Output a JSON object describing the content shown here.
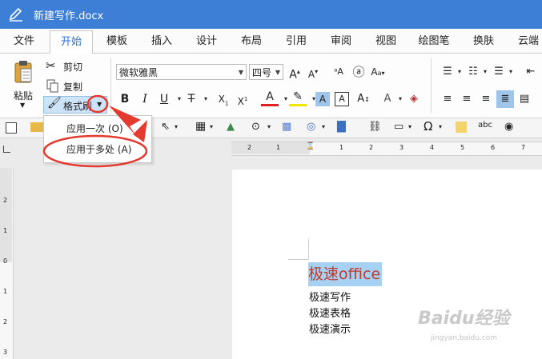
{
  "window": {
    "title": "新建写作.docx"
  },
  "tabs": [
    {
      "label": "文件"
    },
    {
      "label": "开始",
      "active": true
    },
    {
      "label": "模板"
    },
    {
      "label": "插入"
    },
    {
      "label": "设计"
    },
    {
      "label": "布局"
    },
    {
      "label": "引用"
    },
    {
      "label": "审阅"
    },
    {
      "label": "视图"
    },
    {
      "label": "绘图笔"
    },
    {
      "label": "换肤"
    },
    {
      "label": "云端"
    }
  ],
  "clipboard": {
    "paste_label": "粘贴",
    "cut_label": "剪切",
    "copy_label": "复制",
    "format_painter_label": "格式刷"
  },
  "font": {
    "family_value": "微软雅黑",
    "size_value": "四号"
  },
  "format_menu": {
    "items": [
      {
        "label": "应用一次 (O)"
      },
      {
        "label": "应用于多处 (A)"
      }
    ]
  },
  "document": {
    "lines": [
      "极速office",
      "极速写作",
      "极速表格",
      "极速演示"
    ]
  },
  "rulers": {
    "horizontal": [
      "2",
      "1",
      "1",
      "2",
      "3",
      "4",
      "5",
      "6",
      "7"
    ],
    "vertical": [
      "2",
      "1",
      "0",
      "1",
      "2",
      "3"
    ]
  },
  "colors": {
    "titlebar": "#3d7fd7",
    "highlight": "#a6d1f3",
    "annotation": "#e33b30",
    "accent": "#2f6fd1",
    "doc_heading": "#c0392b"
  },
  "watermark": {
    "text": "Baidu经验",
    "sub": "jingyan.baidu.com"
  }
}
